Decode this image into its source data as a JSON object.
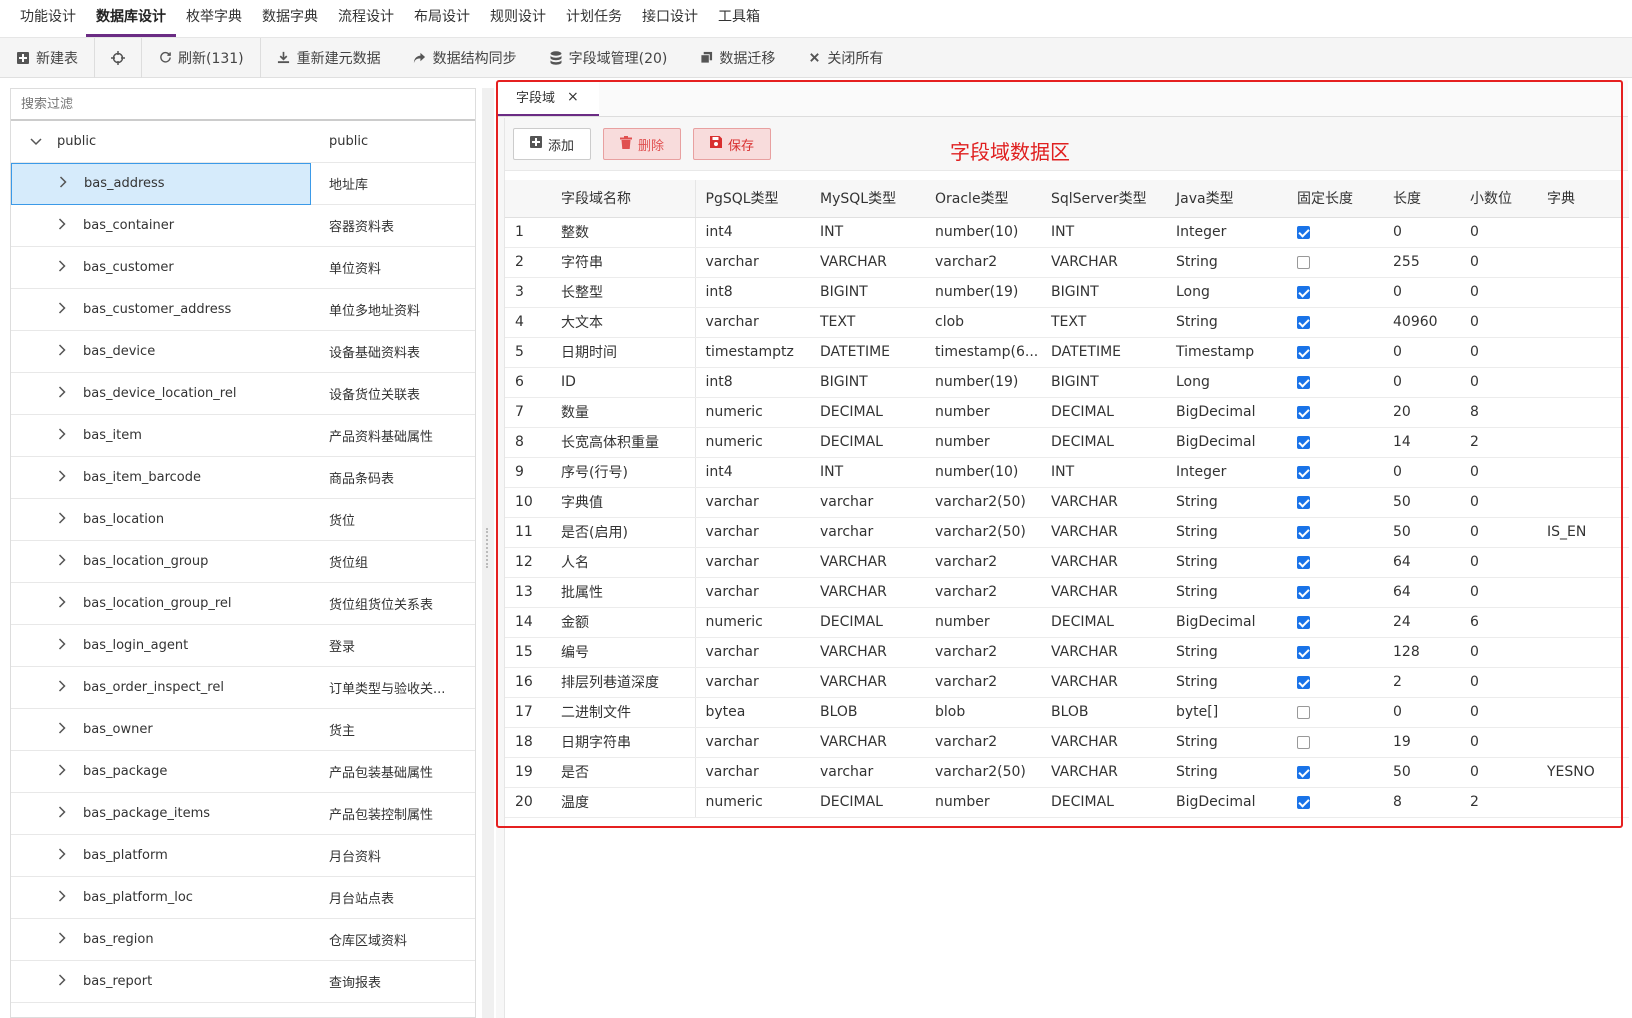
{
  "menu": [
    {
      "label": "功能设计",
      "active": false
    },
    {
      "label": "数据库设计",
      "active": true
    },
    {
      "label": "枚举字典",
      "active": false
    },
    {
      "label": "数据字典",
      "active": false
    },
    {
      "label": "流程设计",
      "active": false
    },
    {
      "label": "布局设计",
      "active": false
    },
    {
      "label": "规则设计",
      "active": false
    },
    {
      "label": "计划任务",
      "active": false
    },
    {
      "label": "接口设计",
      "active": false
    },
    {
      "label": "工具箱",
      "active": false
    }
  ],
  "toolbar": {
    "new_table": "新建表",
    "refresh": "刷新(131)",
    "rebuild_meta": "重新建元数据",
    "sync_structure": "数据结构同步",
    "field_domain": "字段域管理(20)",
    "migrate": "数据迁移",
    "close_all": "关闭所有"
  },
  "search": {
    "placeholder": "搜索过滤"
  },
  "tree": {
    "root": {
      "name": "public",
      "desc": "public"
    },
    "items": [
      {
        "name": "bas_address",
        "desc": "地址库",
        "selected": true
      },
      {
        "name": "bas_container",
        "desc": "容器资料表"
      },
      {
        "name": "bas_customer",
        "desc": "单位资料"
      },
      {
        "name": "bas_customer_address",
        "desc": "单位多地址资料"
      },
      {
        "name": "bas_device",
        "desc": "设备基础资料表"
      },
      {
        "name": "bas_device_location_rel",
        "desc": "设备货位关联表"
      },
      {
        "name": "bas_item",
        "desc": "产品资料基础属性"
      },
      {
        "name": "bas_item_barcode",
        "desc": "商品条码表"
      },
      {
        "name": "bas_location",
        "desc": "货位"
      },
      {
        "name": "bas_location_group",
        "desc": "货位组"
      },
      {
        "name": "bas_location_group_rel",
        "desc": "货位组货位关系表"
      },
      {
        "name": "bas_login_agent",
        "desc": "登录"
      },
      {
        "name": "bas_order_inspect_rel",
        "desc": "订单类型与验收关..."
      },
      {
        "name": "bas_owner",
        "desc": "货主"
      },
      {
        "name": "bas_package",
        "desc": "产品包装基础属性"
      },
      {
        "name": "bas_package_items",
        "desc": "产品包装控制属性"
      },
      {
        "name": "bas_platform",
        "desc": "月台资料"
      },
      {
        "name": "bas_platform_loc",
        "desc": "月台站点表"
      },
      {
        "name": "bas_region",
        "desc": "仓库区域资料"
      },
      {
        "name": "bas_report",
        "desc": "查询报表"
      }
    ]
  },
  "tab": {
    "label": "字段域",
    "close": "×"
  },
  "actions": {
    "add": "添加",
    "delete": "删除",
    "save": "保存"
  },
  "annotation": "字段域数据区",
  "table": {
    "columns": [
      "",
      "字段域名称",
      "PgSQL类型",
      "MySQL类型",
      "Oracle类型",
      "SqlServer类型",
      "Java类型",
      "固定长度",
      "长度",
      "小数位",
      "字典"
    ],
    "rows": [
      [
        "1",
        "整数",
        "int4",
        "INT",
        "number(10)",
        "INT",
        "Integer",
        true,
        "0",
        "0",
        ""
      ],
      [
        "2",
        "字符串",
        "varchar",
        "VARCHAR",
        "varchar2",
        "VARCHAR",
        "String",
        false,
        "255",
        "0",
        ""
      ],
      [
        "3",
        "长整型",
        "int8",
        "BIGINT",
        "number(19)",
        "BIGINT",
        "Long",
        true,
        "0",
        "0",
        ""
      ],
      [
        "4",
        "大文本",
        "varchar",
        "TEXT",
        "clob",
        "TEXT",
        "String",
        true,
        "40960",
        "0",
        ""
      ],
      [
        "5",
        "日期时间",
        "timestamptz",
        "DATETIME",
        "timestamp(6...",
        "DATETIME",
        "Timestamp",
        true,
        "0",
        "0",
        ""
      ],
      [
        "6",
        "ID",
        "int8",
        "BIGINT",
        "number(19)",
        "BIGINT",
        "Long",
        true,
        "0",
        "0",
        ""
      ],
      [
        "7",
        "数量",
        "numeric",
        "DECIMAL",
        "number",
        "DECIMAL",
        "BigDecimal",
        true,
        "20",
        "8",
        ""
      ],
      [
        "8",
        "长宽高体积重量",
        "numeric",
        "DECIMAL",
        "number",
        "DECIMAL",
        "BigDecimal",
        true,
        "14",
        "2",
        ""
      ],
      [
        "9",
        "序号(行号)",
        "int4",
        "INT",
        "number(10)",
        "INT",
        "Integer",
        true,
        "0",
        "0",
        ""
      ],
      [
        "10",
        "字典值",
        "varchar",
        "varchar",
        "varchar2(50)",
        "VARCHAR",
        "String",
        true,
        "50",
        "0",
        ""
      ],
      [
        "11",
        "是否(启用)",
        "varchar",
        "varchar",
        "varchar2(50)",
        "VARCHAR",
        "String",
        true,
        "50",
        "0",
        "IS_EN"
      ],
      [
        "12",
        "人名",
        "varchar",
        "VARCHAR",
        "varchar2",
        "VARCHAR",
        "String",
        true,
        "64",
        "0",
        ""
      ],
      [
        "13",
        "批属性",
        "varchar",
        "VARCHAR",
        "varchar2",
        "VARCHAR",
        "String",
        true,
        "64",
        "0",
        ""
      ],
      [
        "14",
        "金额",
        "numeric",
        "DECIMAL",
        "number",
        "DECIMAL",
        "BigDecimal",
        true,
        "24",
        "6",
        ""
      ],
      [
        "15",
        "编号",
        "varchar",
        "VARCHAR",
        "varchar2",
        "VARCHAR",
        "String",
        true,
        "128",
        "0",
        ""
      ],
      [
        "16",
        "排层列巷道深度",
        "varchar",
        "VARCHAR",
        "varchar2",
        "VARCHAR",
        "String",
        true,
        "2",
        "0",
        ""
      ],
      [
        "17",
        "二进制文件",
        "bytea",
        "BLOB",
        "blob",
        "BLOB",
        "byte[]",
        false,
        "0",
        "0",
        ""
      ],
      [
        "18",
        "日期字符串",
        "varchar",
        "VARCHAR",
        "varchar2",
        "VARCHAR",
        "String",
        false,
        "19",
        "0",
        ""
      ],
      [
        "19",
        "是否",
        "varchar",
        "varchar",
        "varchar2(50)",
        "VARCHAR",
        "String",
        true,
        "50",
        "0",
        "YESNO"
      ],
      [
        "20",
        "温度",
        "numeric",
        "DECIMAL",
        "number",
        "DECIMAL",
        "BigDecimal",
        true,
        "8",
        "2",
        ""
      ]
    ]
  },
  "colors": {
    "accent": "#6b2c84",
    "highlight": "#e52020",
    "selected_row": "#d6ebfb"
  }
}
